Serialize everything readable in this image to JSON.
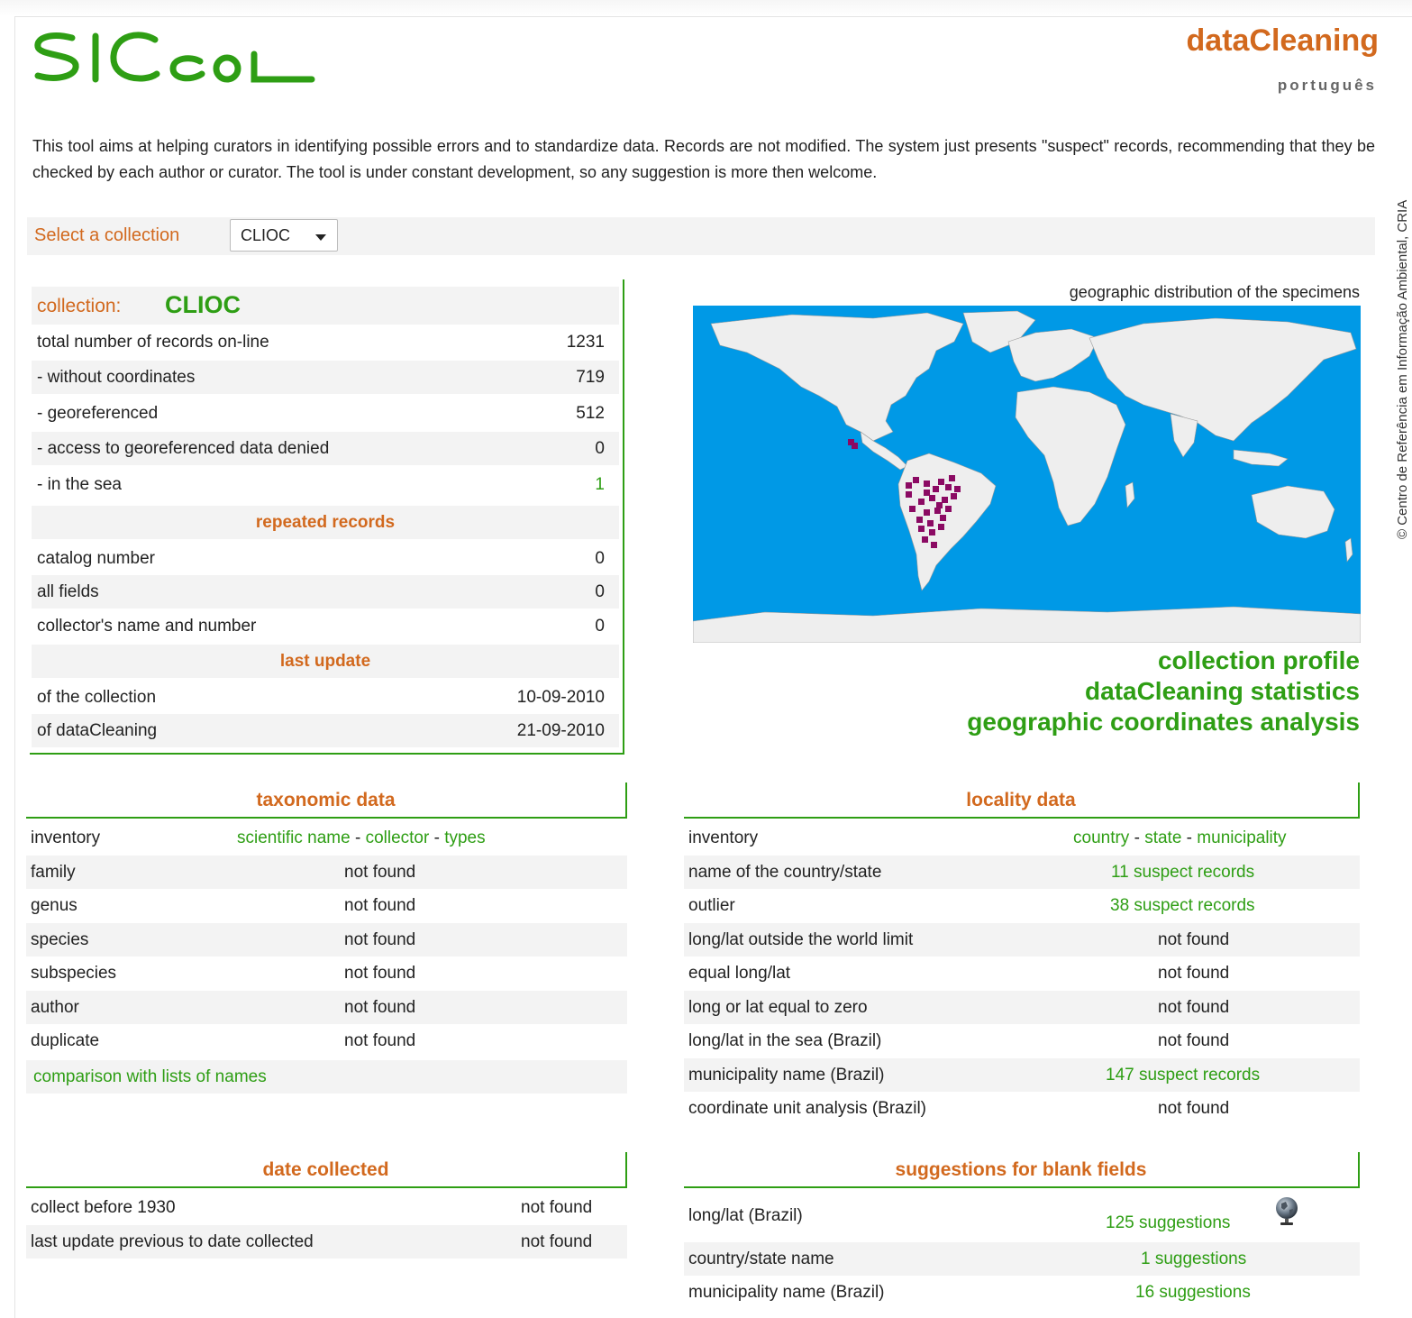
{
  "header": {
    "logo_text": "SICol",
    "app_title": "dataCleaning",
    "language_link": "português",
    "copyright": "© Centro de Referência em Informação Ambiental, CRIA"
  },
  "intro": "This tool aims at helping curators in identifying possible errors and to standardize data. Records are not modified. The system just presents \"suspect\" records, recommending that they be checked by each author or curator. The tool is under constant development, so any suggestion is more then welcome.",
  "collection_select": {
    "label": "Select a collection",
    "value": "CLIOC"
  },
  "collection": {
    "label": "collection:",
    "name": "CLIOC",
    "stats": [
      {
        "label": "total number of records on-line",
        "value": "1231"
      },
      {
        "label": "- without coordinates",
        "value": "719"
      },
      {
        "label": "- georeferenced",
        "value": "512"
      },
      {
        "label": "- access to georeferenced data denied",
        "value": "0"
      },
      {
        "label": "- in the sea",
        "value": "1"
      }
    ],
    "repeated_title": "repeated records",
    "repeated": [
      {
        "label": "catalog number",
        "value": "0"
      },
      {
        "label": "all fields",
        "value": "0"
      },
      {
        "label": "collector's name and number",
        "value": "0"
      }
    ],
    "update_title": "last update",
    "updates": [
      {
        "label": "of the collection",
        "value": "10-09-2010"
      },
      {
        "label": "of dataCleaning",
        "value": "21-09-2010"
      }
    ]
  },
  "map": {
    "caption": "geographic distribution of the specimens",
    "ocean_color": "#0099e6",
    "land_color": "#eeeeee",
    "point_color": "#8b0a63",
    "links": [
      "collection profile",
      "dataCleaning statistics",
      "geographic coordinates analysis"
    ]
  },
  "taxonomic": {
    "title": "taxonomic data",
    "inventory_label": "inventory",
    "inventory_links": [
      "scientific name",
      "collector",
      "types"
    ],
    "rows": [
      {
        "label": "family",
        "value": "not found"
      },
      {
        "label": "genus",
        "value": "not found"
      },
      {
        "label": "species",
        "value": "not found"
      },
      {
        "label": "subspecies",
        "value": "not found"
      },
      {
        "label": "author",
        "value": "not found"
      },
      {
        "label": "duplicate",
        "value": "not found"
      }
    ],
    "comparison_link": "comparison with lists of names"
  },
  "locality": {
    "title": "locality data",
    "inventory_label": "inventory",
    "inventory_links": [
      "country",
      "state",
      "municipality"
    ],
    "rows": [
      {
        "label": "name of the country/state",
        "value": "11 suspect records"
      },
      {
        "label": "outlier",
        "value": "38 suspect records"
      },
      {
        "label": "long/lat outside the world limit",
        "value": "not found"
      },
      {
        "label": "equal long/lat",
        "value": "not found"
      },
      {
        "label": "long or lat equal to zero",
        "value": "not found"
      },
      {
        "label": "long/lat in the sea (Brazil)",
        "value": "not found"
      },
      {
        "label": "municipality name (Brazil)",
        "value": "147 suspect records"
      },
      {
        "label": "coordinate unit analysis (Brazil)",
        "value": "not found"
      }
    ]
  },
  "date_collected": {
    "title": "date collected",
    "rows": [
      {
        "label": "collect before 1930",
        "value": "not found"
      },
      {
        "label": "last update previous to date collected",
        "value": "not found"
      }
    ]
  },
  "suggestions": {
    "title": "suggestions for blank fields",
    "rows": [
      {
        "label": "long/lat (Brazil)",
        "value": "125 suggestions",
        "icon": "globe-icon"
      },
      {
        "label": "country/state name",
        "value": "1 suggestions"
      },
      {
        "label": "municipality name (Brazil)",
        "value": "16 suggestions"
      }
    ]
  }
}
